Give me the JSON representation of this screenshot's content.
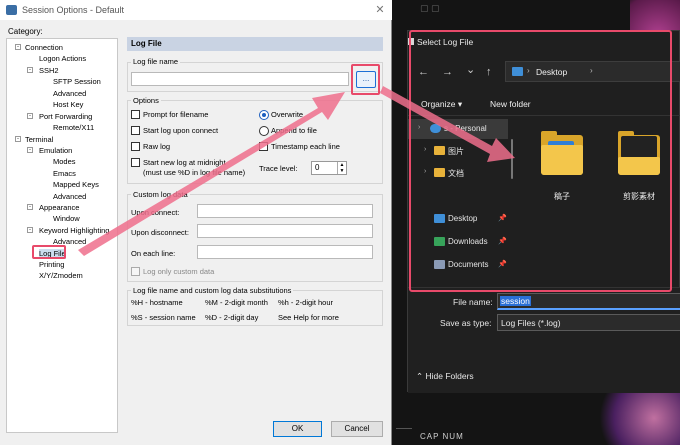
{
  "window": {
    "title": "Session Options - Default",
    "close_glyph": "✕"
  },
  "category": {
    "label": "Category:",
    "items": [
      {
        "label": "Connection",
        "toggle": "-"
      },
      {
        "label": "Logon Actions"
      },
      {
        "label": "SSH2",
        "toggle": "-"
      },
      {
        "label": "SFTP Session"
      },
      {
        "label": "Advanced"
      },
      {
        "label": "Host Key"
      },
      {
        "label": "Port Forwarding",
        "toggle": "-"
      },
      {
        "label": "Remote/X11"
      },
      {
        "label": "Terminal",
        "toggle": "-"
      },
      {
        "label": "Emulation",
        "toggle": "-"
      },
      {
        "label": "Modes"
      },
      {
        "label": "Emacs"
      },
      {
        "label": "Mapped Keys"
      },
      {
        "label": "Advanced"
      },
      {
        "label": "Appearance",
        "toggle": "-"
      },
      {
        "label": "Window"
      },
      {
        "label": "Keyword Highlighting",
        "toggle": "-"
      },
      {
        "label": "Advanced"
      },
      {
        "label": "Log File"
      },
      {
        "label": "Printing"
      },
      {
        "label": "X/Y/Zmodem"
      }
    ]
  },
  "panel": {
    "header": "Log File",
    "log_file_name": {
      "label": "Log file name",
      "value": "",
      "browse_label": "..."
    },
    "options": {
      "label": "Options",
      "prompt_for_filename": "Prompt for filename",
      "start_log_upon_connect": "Start log upon connect",
      "raw_log": "Raw log",
      "start_new_log_line1": "Start new log at midnight",
      "start_new_log_line2": "(must use %D in log file name)",
      "overwrite": "Overwrite",
      "append_to_file": "Append to file",
      "timestamp_each_line": "Timestamp each line",
      "trace_level_label": "Trace level:",
      "trace_level_value": "0"
    },
    "custom_log_data": {
      "label": "Custom log data",
      "upon_connect": "Upon connect:",
      "upon_disconnect": "Upon disconnect:",
      "on_each_line": "On each line:",
      "log_only_custom": "Log only custom data"
    },
    "substitutions": {
      "label": "Log file name and custom log data substitutions",
      "h_host": "%H - hostname",
      "m_month": "%M - 2-digit month",
      "h_hour": "%h - 2-digit hour",
      "s_session": "%S - session name",
      "d_day": "%D - 2-digit day",
      "see_help": "See Help for more"
    }
  },
  "buttons": {
    "ok": "OK",
    "cancel": "Cancel"
  },
  "file_dialog": {
    "title": "Select Log File",
    "nav_back": "←",
    "nav_forward": "→",
    "nav_down": "⌄",
    "nav_up": "↑",
    "address_chev": "›",
    "address": "Desktop",
    "organize": "Organize ▾",
    "new_folder": "New folder",
    "nav_items": [
      {
        "label": "s - Personal"
      },
      {
        "label": "图片"
      },
      {
        "label": "文档"
      },
      {
        "label": "Desktop"
      },
      {
        "label": "Downloads"
      },
      {
        "label": "Documents"
      }
    ],
    "folders": [
      "稿子",
      "剪影素材"
    ],
    "file_name_label": "File name:",
    "file_name_value": "session",
    "save_as_type_label": "Save as type:",
    "save_as_type_value": "Log Files (*.log)",
    "hide_folders": "⌃  Hide Folders",
    "pin_glyph": "📌"
  },
  "taskbar": {
    "indicators": "CAP NUM"
  },
  "colors": {
    "highlight": "#e84a6a",
    "accent": "#0078d7",
    "dark_bg": "#1f1f1f"
  }
}
